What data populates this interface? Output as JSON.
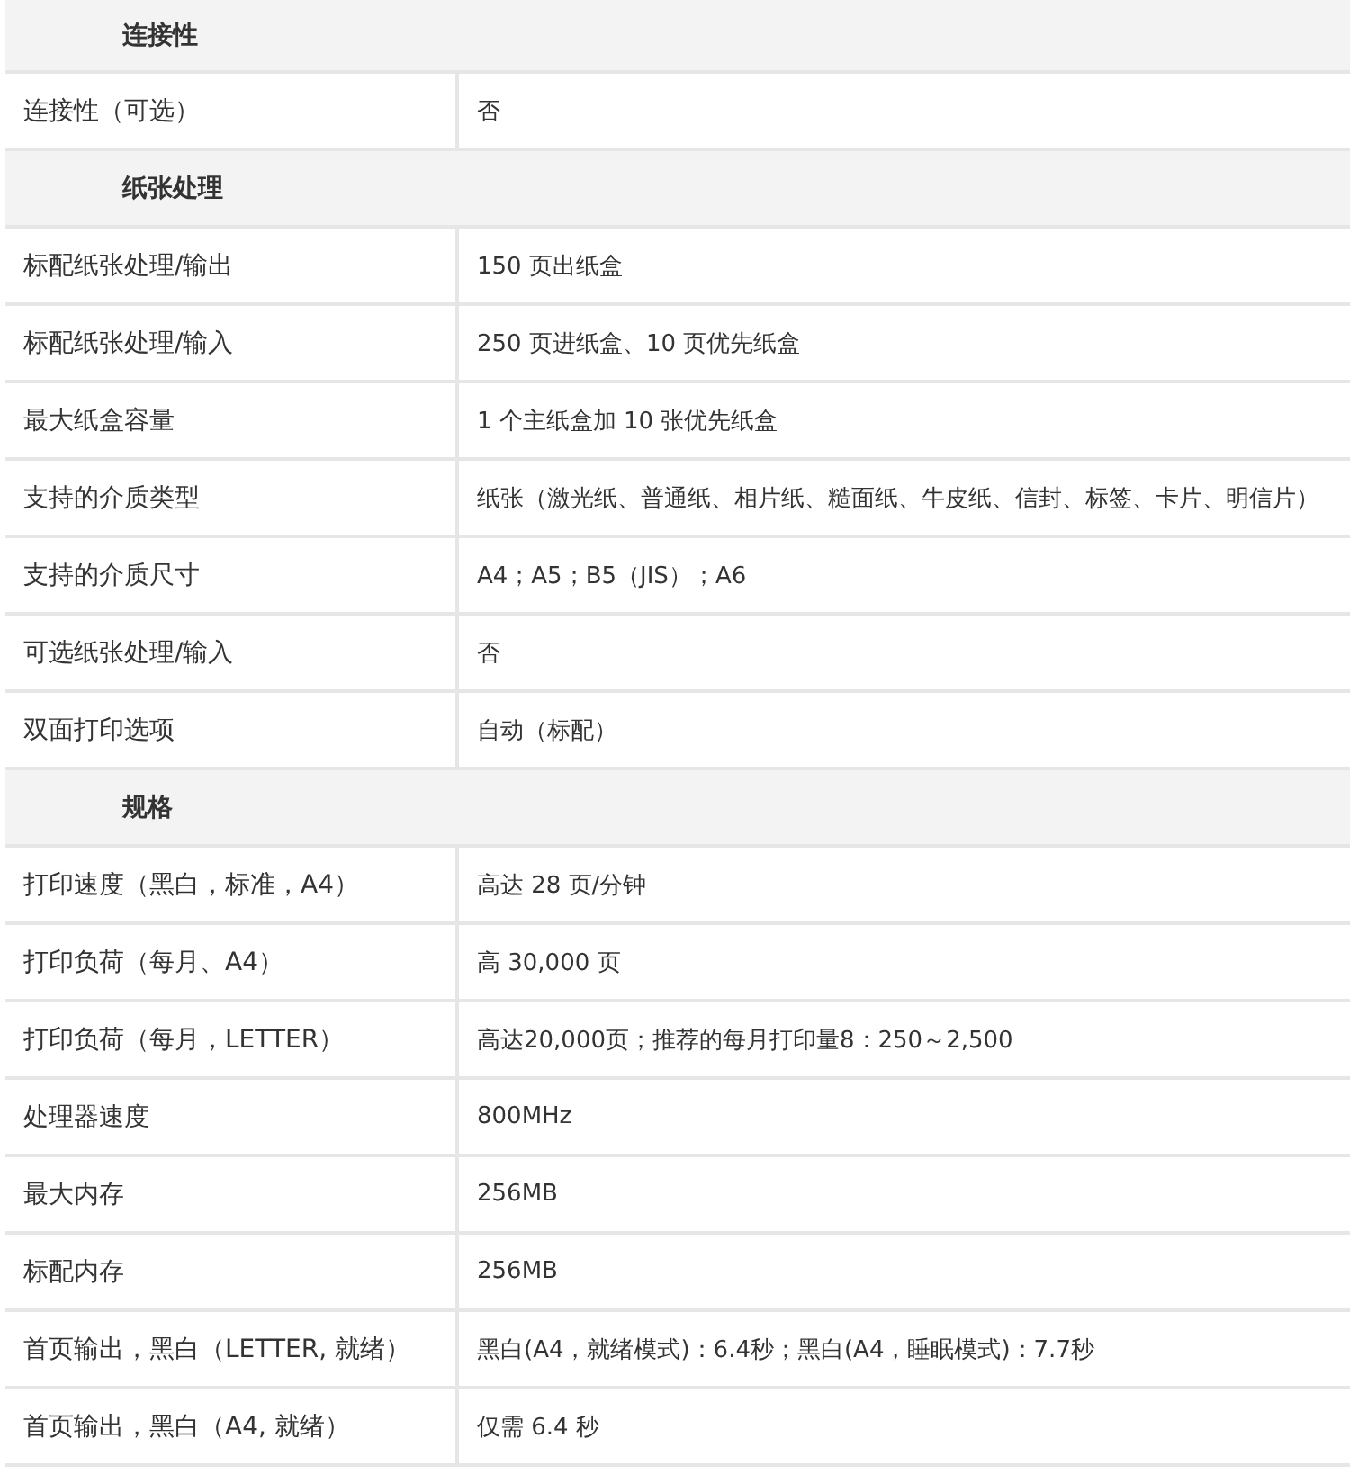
{
  "sections": [
    {
      "title": "连接性",
      "rows": [
        {
          "label": "连接性（可选）",
          "value": "否"
        }
      ]
    },
    {
      "title": "纸张处理",
      "rows": [
        {
          "label": "标配纸张处理/输出",
          "value": "150 页出纸盒"
        },
        {
          "label": "标配纸张处理/输入",
          "value": "250 页进纸盒、10 页优先纸盒"
        },
        {
          "label": "最大纸盒容量",
          "value": "1 个主纸盒加 10 张优先纸盒"
        },
        {
          "label": "支持的介质类型",
          "value": "纸张（激光纸、普通纸、相片纸、糙面纸、牛皮纸、信封、标签、卡片、明信片）"
        },
        {
          "label": "支持的介质尺寸",
          "value": "A4；A5；B5（JIS）；A6"
        },
        {
          "label": "可选纸张处理/输入",
          "value": "否"
        },
        {
          "label": "双面打印选项",
          "value": "自动（标配）"
        }
      ]
    },
    {
      "title": "规格",
      "rows": [
        {
          "label": "打印速度（黑白，标准，A4）",
          "value": "高达 28 页/分钟"
        },
        {
          "label": "打印负荷（每月、A4）",
          "value": "高 30,000 页"
        },
        {
          "label": "打印负荷（每月，LETTER）",
          "value": "高达20,000页；推荐的每月打印量8：250～2,500"
        },
        {
          "label": "处理器速度",
          "value": "800MHz"
        },
        {
          "label": "最大内存",
          "value": "256MB"
        },
        {
          "label": "标配内存",
          "value": "256MB"
        },
        {
          "label": "首页输出，黑白（LETTER, 就绪）",
          "value": "黑白(A4，就绪模式)：6.4秒；黑白(A4，睡眠模式)：7.7秒"
        },
        {
          "label": "首页输出，黑白（A4, 就绪）",
          "value": "仅需 6.4 秒"
        }
      ]
    }
  ]
}
